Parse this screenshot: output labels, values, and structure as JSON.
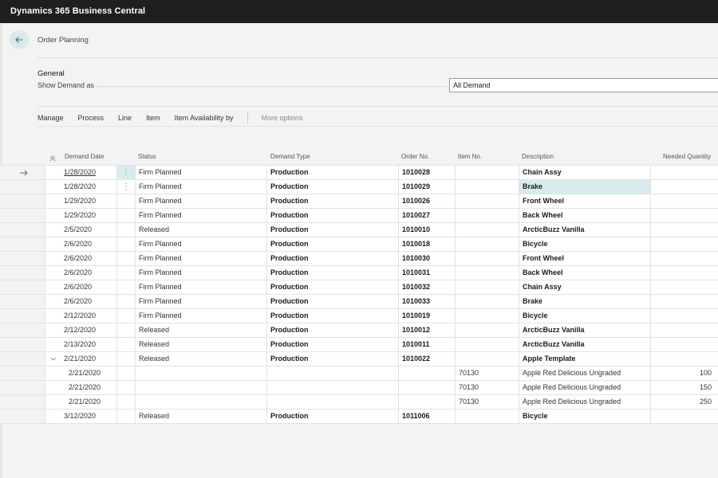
{
  "app": {
    "title": "Dynamics 365 Business Central"
  },
  "page": {
    "title": "Order Planning"
  },
  "general": {
    "section_label": "General",
    "show_demand_label": "Show Demand as",
    "show_demand_value": "All Demand"
  },
  "actions": {
    "items": [
      "Manage",
      "Process",
      "Line",
      "Item",
      "Item Availability by"
    ],
    "more": "More options"
  },
  "table": {
    "columns": [
      "Demand Date",
      "Status",
      "Demand Type",
      "Order No.",
      "Item No.",
      "Description",
      "Needed Quantity"
    ],
    "rows": [
      {
        "date": "1/28/2020",
        "status": "Firm Planned",
        "type": "Production",
        "order": "1010028",
        "item": "",
        "desc": "Chain Assy",
        "qty": "",
        "current": true,
        "menu": true,
        "underline": true
      },
      {
        "date": "1/28/2020",
        "status": "Firm Planned",
        "type": "Production",
        "order": "1010029",
        "item": "",
        "desc": "Brake",
        "qty": "",
        "menu": true,
        "highlight": true
      },
      {
        "date": "1/29/2020",
        "status": "Firm Planned",
        "type": "Production",
        "order": "1010026",
        "item": "",
        "desc": "Front Wheel",
        "qty": ""
      },
      {
        "date": "1/29/2020",
        "status": "Firm Planned",
        "type": "Production",
        "order": "1010027",
        "item": "",
        "desc": "Back Wheel",
        "qty": ""
      },
      {
        "date": "2/5/2020",
        "status": "Released",
        "type": "Production",
        "order": "1010010",
        "item": "",
        "desc": "ArcticBuzz Vanilla",
        "qty": ""
      },
      {
        "date": "2/6/2020",
        "status": "Firm Planned",
        "type": "Production",
        "order": "1010018",
        "item": "",
        "desc": "Bicycle",
        "qty": ""
      },
      {
        "date": "2/6/2020",
        "status": "Firm Planned",
        "type": "Production",
        "order": "1010030",
        "item": "",
        "desc": "Front Wheel",
        "qty": ""
      },
      {
        "date": "2/6/2020",
        "status": "Firm Planned",
        "type": "Production",
        "order": "1010031",
        "item": "",
        "desc": "Back Wheel",
        "qty": ""
      },
      {
        "date": "2/6/2020",
        "status": "Firm Planned",
        "type": "Production",
        "order": "1010032",
        "item": "",
        "desc": "Chain Assy",
        "qty": ""
      },
      {
        "date": "2/6/2020",
        "status": "Firm Planned",
        "type": "Production",
        "order": "1010033",
        "item": "",
        "desc": "Brake",
        "qty": ""
      },
      {
        "date": "2/12/2020",
        "status": "Firm Planned",
        "type": "Production",
        "order": "1010019",
        "item": "",
        "desc": "Bicycle",
        "qty": ""
      },
      {
        "date": "2/12/2020",
        "status": "Released",
        "type": "Production",
        "order": "1010012",
        "item": "",
        "desc": "ArcticBuzz Vanilla",
        "qty": ""
      },
      {
        "date": "2/13/2020",
        "status": "Released",
        "type": "Production",
        "order": "1010011",
        "item": "",
        "desc": "ArcticBuzz Vanilla",
        "qty": ""
      },
      {
        "date": "2/21/2020",
        "status": "Released",
        "type": "Production",
        "order": "1010022",
        "item": "",
        "desc": "Apple Template",
        "qty": "",
        "expanded": true
      },
      {
        "date": "2/21/2020",
        "status": "",
        "type": "",
        "order": "",
        "item": "70130",
        "desc": "Apple Red Delicious Ungraded",
        "qty": "100",
        "child": true
      },
      {
        "date": "2/21/2020",
        "status": "",
        "type": "",
        "order": "",
        "item": "70130",
        "desc": "Apple Red Delicious Ungraded",
        "qty": "150",
        "child": true
      },
      {
        "date": "2/21/2020",
        "status": "",
        "type": "",
        "order": "",
        "item": "70130",
        "desc": "Apple Red Delicious Ungraded",
        "qty": "250",
        "child": true
      },
      {
        "date": "3/12/2020",
        "status": "Released",
        "type": "Production",
        "order": "1011006",
        "item": "",
        "desc": "Bicycle",
        "qty": ""
      }
    ]
  },
  "icons": {
    "back": "back-arrow-icon",
    "current_row": "right-arrow-icon",
    "menu": "more-vertical-icon",
    "expand": "chevron-down-icon",
    "sort": "sort-up-icon"
  },
  "colors": {
    "topbar": "#1f1f1f",
    "accent": "#d7ecee",
    "back_button": "#d9e9ec"
  }
}
